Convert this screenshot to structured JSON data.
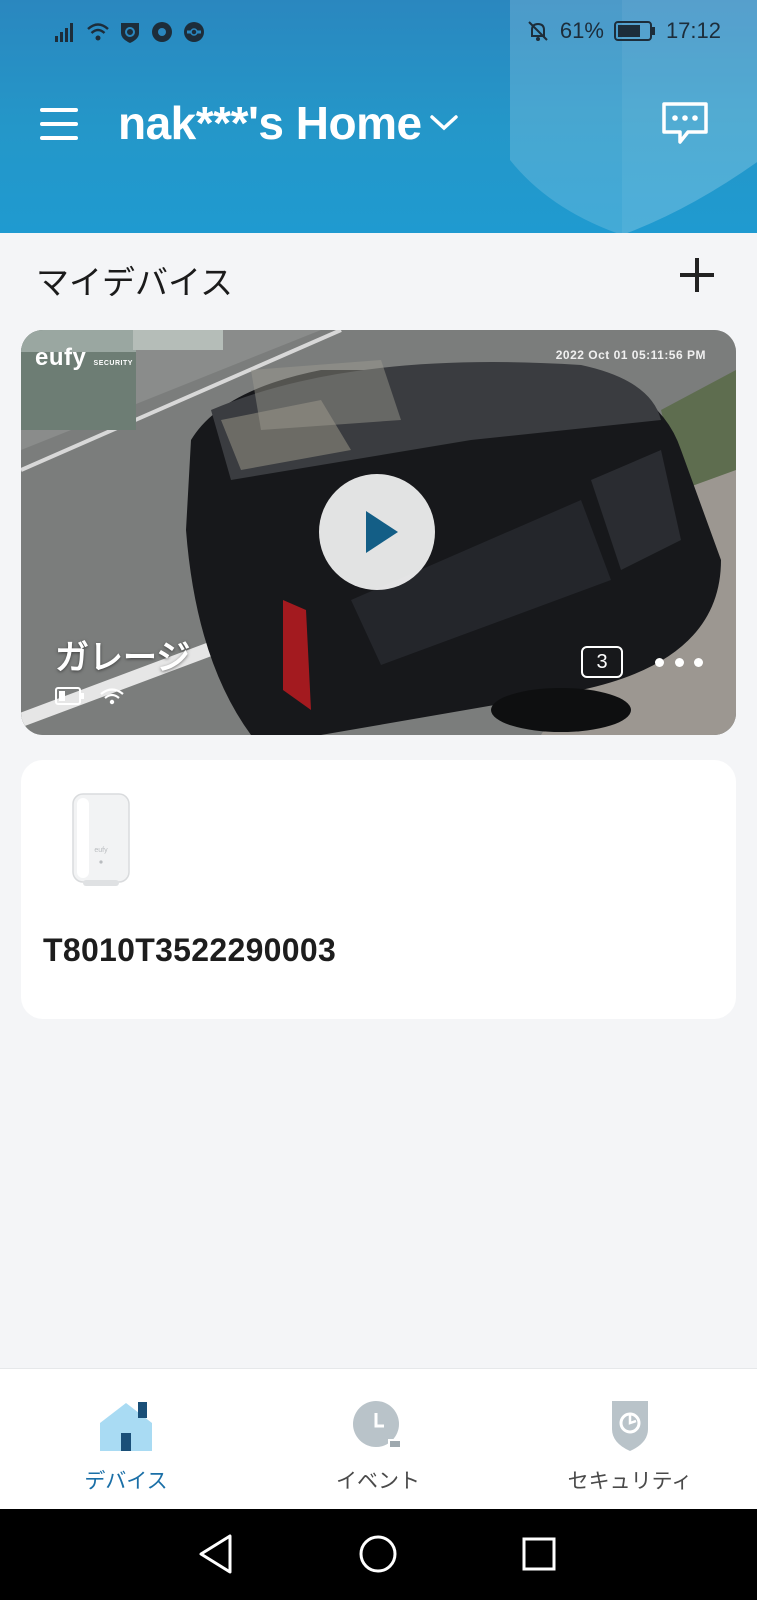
{
  "status_bar": {
    "battery_percent": "61%",
    "time": "17:12"
  },
  "header": {
    "home_name": "nak***'s Home"
  },
  "devices_section": {
    "title": "マイデバイス"
  },
  "camera": {
    "name": "ガレージ",
    "logo": "eufy",
    "logo_sub": "SECURITY",
    "timestamp": "2022 Oct 01 05:11:56 PM",
    "event_count": "3"
  },
  "hub": {
    "name": "T8010T3522290003",
    "image_logo": "eufy"
  },
  "tabs": [
    {
      "label": "デバイス",
      "icon": "home-icon",
      "active": true
    },
    {
      "label": "イベント",
      "icon": "clock-icon",
      "active": false
    },
    {
      "label": "セキュリティ",
      "icon": "shield-icon",
      "active": false
    }
  ],
  "colors": {
    "header": "#2497c9",
    "accent": "#1a6fa7",
    "background": "#f4f5f7"
  }
}
